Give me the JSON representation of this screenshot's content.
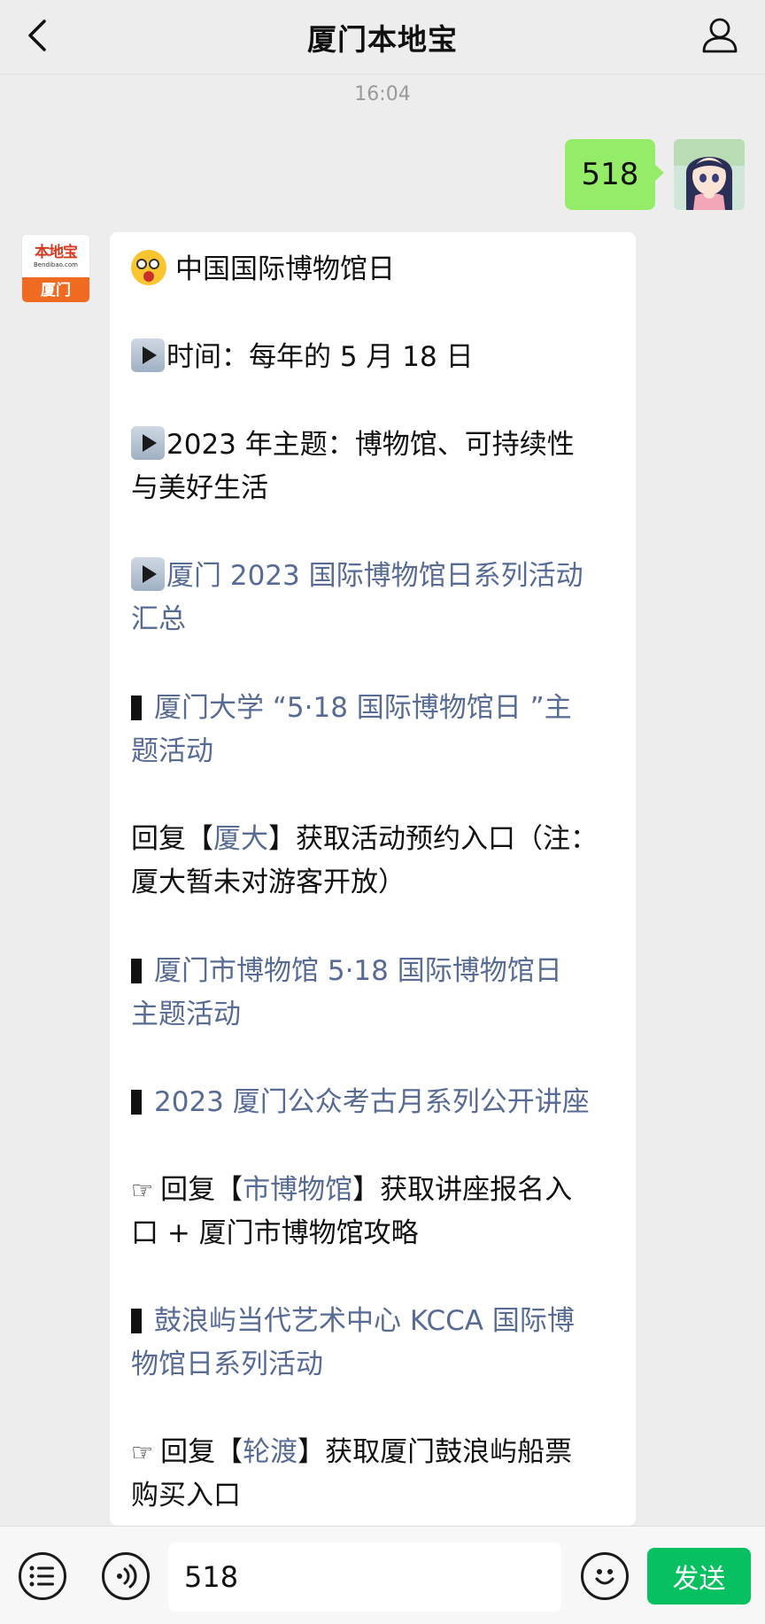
{
  "header": {
    "title": "厦门本地宝"
  },
  "timestamp": "16:04",
  "user_message": {
    "text": "518"
  },
  "bot_avatar": {
    "brand": "本地宝",
    "domain": "Bendibao.com",
    "city": "厦门"
  },
  "bot_message": {
    "lines": [
      {
        "text": "中国国际博物馆日"
      },
      {
        "text": "时间：每年的 5 月 18 日"
      },
      {
        "text": "2023 年主题：博物馆、可持续性"
      },
      {
        "text": "与美好生活"
      },
      {
        "text": "厦门 2023 国际博物馆日系列活动"
      },
      {
        "text": "汇总"
      },
      {
        "text": "厦门大学 “5·18 国际博物馆日 ”主"
      },
      {
        "text": "题活动"
      },
      {
        "pre": "回复【",
        "link": "厦大",
        "post": "】获取活动预约入口（注："
      },
      {
        "text": "厦大暂未对游客开放）"
      },
      {
        "text": "厦门市博物馆 5·18 国际博物馆日"
      },
      {
        "text": "主题活动"
      },
      {
        "text": "2023 厦门公众考古月系列公开讲座"
      },
      {
        "pre": "回复【",
        "link": "市博物馆",
        "post": "】获取讲座报名入"
      },
      {
        "text": "口 + 厦门市博物馆攻略"
      },
      {
        "text": "鼓浪屿当代艺术中心 KCCA 国际博"
      },
      {
        "text": "物馆日系列活动"
      },
      {
        "pre": "回复【",
        "link": "轮渡",
        "post": "】获取厦门鼓浪屿船票"
      },
      {
        "text": "购买入口"
      }
    ]
  },
  "input": {
    "value": "518"
  },
  "send_button": {
    "label": "发送"
  },
  "colors": {
    "background": "#ededed",
    "user_bubble": "#95ec69",
    "link": "#576b95",
    "send_button": "#07c160"
  }
}
